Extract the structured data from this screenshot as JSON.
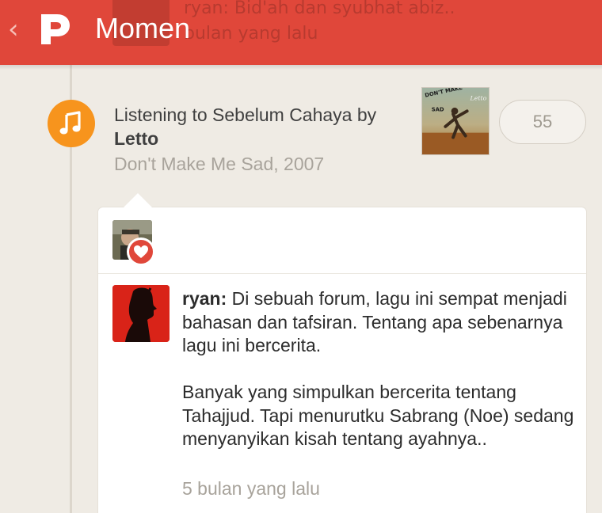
{
  "header": {
    "title": "Momen",
    "ghost_line1": "ryan: Bid'ah dan syubhat abiz..",
    "ghost_line2": "bulan yang lalu"
  },
  "moment": {
    "prefix": "Listening to Sebelum Cahaya by ",
    "artist": "Letto",
    "album": "Don't Make Me Sad, 2007",
    "album_art_text_top": "DON'T MAKE",
    "album_art_text_bottom": "SAD",
    "album_art_brand": "Letto",
    "count": "55"
  },
  "comment": {
    "author": "ryan:",
    "para1": "Di sebuah forum, lagu ini sempat menjadi bahasan dan tafsiran. Tentang apa sebenarnya lagu ini bercerita.",
    "para2": "Banyak yang simpulkan bercerita tentang Tahajjud. Tapi menurutku Sabrang (Noe) sedang menyanyikan kisah tentang ayahnya..",
    "time": "5 bulan yang lalu"
  },
  "colors": {
    "header": "#e0473a",
    "background": "#efebe4",
    "music_badge": "#f7941d",
    "heart": "#e0473a"
  },
  "icons": {
    "back": "chevron-left-icon",
    "logo": "path-logo-icon",
    "music": "music-note-icon",
    "heart": "heart-icon"
  }
}
